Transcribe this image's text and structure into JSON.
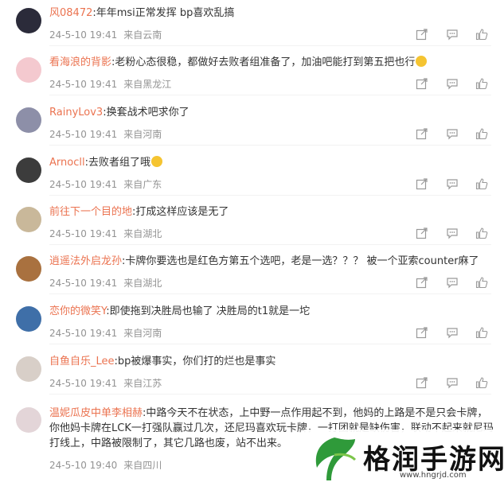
{
  "comments": [
    {
      "user": "风08472",
      "text": ":年年msi正常发挥 bp喜欢乱搞",
      "time": "24-5-10 19:41",
      "place": "来自云南",
      "avatar_color": "#2b2b3a",
      "emoji": false
    },
    {
      "user": "看海浪的背影",
      "text": ":老粉心态很稳，都做好去败者组准备了，加油吧能打到第五把也行",
      "time": "24-5-10 19:41",
      "place": "来自黑龙江",
      "avatar_color": "#f4c9cf",
      "emoji": true
    },
    {
      "user": "RainyLov3",
      "text": ":换套战术吧求你了",
      "time": "24-5-10 19:41",
      "place": "来自河南",
      "avatar_color": "#8d8fa8",
      "emoji": false
    },
    {
      "user": "Arnocll",
      "text": ":去败者组了哦",
      "time": "24-5-10 19:41",
      "place": "来自广东",
      "avatar_color": "#3c3c3c",
      "emoji": true
    },
    {
      "user": "前往下一个目的地",
      "text": ":打成这样应该是无了",
      "time": "24-5-10 19:41",
      "place": "来自湖北",
      "avatar_color": "#c9b89a",
      "emoji": false
    },
    {
      "user": "逍遥法外启龙孙",
      "text": ":卡牌你要选也是红色方第五个选吧，老是一选？？？ 被一个亚索counter麻了",
      "time": "24-5-10 19:41",
      "place": "来自湖北",
      "avatar_color": "#a9713f",
      "emoji": false
    },
    {
      "user": "恋你的微笑Y",
      "text": ":即使拖到决胜局也输了 决胜局的t1就是一坨",
      "time": "24-5-10 19:41",
      "place": "来自河南",
      "avatar_color": "#3f6fa8",
      "emoji": false
    },
    {
      "user": "自鱼自乐_Lee",
      "text": ":bp被爆事实，你们打的烂也是事实",
      "time": "24-5-10 19:41",
      "place": "来自江苏",
      "avatar_color": "#d8cfc8",
      "emoji": false
    },
    {
      "user": "温妮瓜皮中单李相赫",
      "text": ":中路今天不在状态，上中野一点作用起不到，他妈的上路是不是只会卡牌，你他妈卡牌在LCK一打强队赢过几次，还尼玛喜欢玩卡牌，一打团就是缺伤害，联动不起来就尼玛打线上，中路被限制了，其它几路也废，站不出来。",
      "time": "24-5-10 19:40",
      "place": "来自四川",
      "avatar_color": "#e3d5d8",
      "emoji": false
    }
  ],
  "icons": {
    "share": "share-icon",
    "comment": "comment-icon",
    "like": "like-icon"
  },
  "watermark": {
    "text": "格润手游网",
    "url": "www.hngrjd.com"
  }
}
